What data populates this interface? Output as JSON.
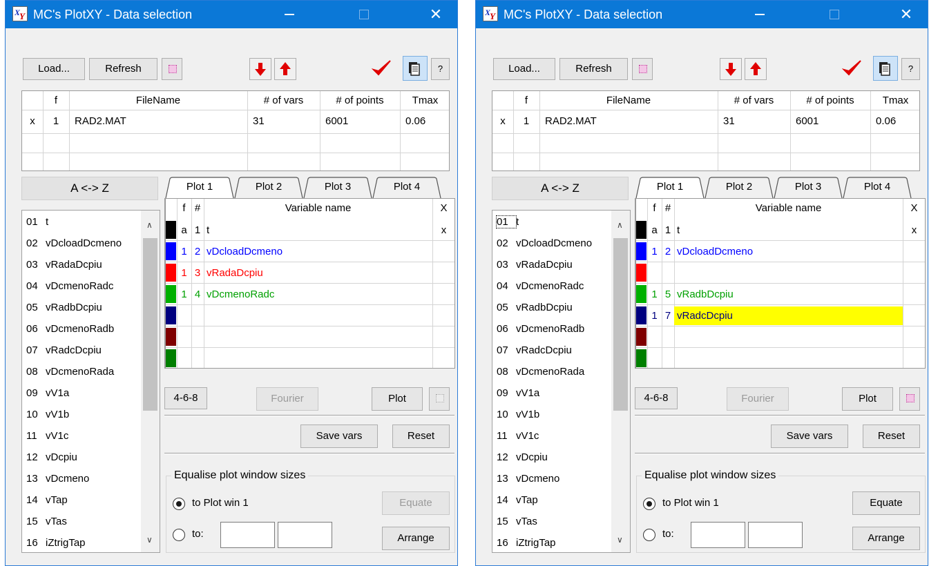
{
  "windows": [
    {
      "title": "MC's PlotXY - Data selection",
      "toolbar": {
        "load": "Load...",
        "refresh": "Refresh",
        "help": "?"
      },
      "files": {
        "headers": [
          "f",
          "FileName",
          "# of vars",
          "# of points",
          "Tmax"
        ],
        "rows": [
          {
            "sel": "x",
            "f": "1",
            "name": "RAD2.MAT",
            "vars": "31",
            "points": "6001",
            "tmax": "0.06"
          }
        ]
      },
      "az_label": "A <-> Z",
      "var_list": [
        {
          "num": "01",
          "name": "t"
        },
        {
          "num": "02",
          "name": "vDcloadDcmeno"
        },
        {
          "num": "03",
          "name": "vRadaDcpiu"
        },
        {
          "num": "04",
          "name": "vDcmenoRadc"
        },
        {
          "num": "05",
          "name": "vRadbDcpiu"
        },
        {
          "num": "06",
          "name": "vDcmenoRadb"
        },
        {
          "num": "07",
          "name": "vRadcDcpiu"
        },
        {
          "num": "08",
          "name": "vDcmenoRada"
        },
        {
          "num": "09",
          "name": "vV1a"
        },
        {
          "num": "10",
          "name": "vV1b"
        },
        {
          "num": "11",
          "name": "vV1c"
        },
        {
          "num": "12",
          "name": "vDcpiu"
        },
        {
          "num": "13",
          "name": "vDcmeno"
        },
        {
          "num": "14",
          "name": "vTap"
        },
        {
          "num": "15",
          "name": "vTas"
        },
        {
          "num": "16",
          "name": "iZtrigTap"
        }
      ],
      "tabs": [
        "Plot 1",
        "Plot 2",
        "Plot 3",
        "Plot 4"
      ],
      "active_tab": "Plot 1",
      "plot_vars": {
        "headers": [
          "f",
          "#",
          "Variable name",
          "X"
        ],
        "rows": [
          {
            "color": "#000000",
            "f": "a",
            "num": "1",
            "name": "t",
            "x": "x",
            "text_color": "#000000",
            "highlight": false
          },
          {
            "color": "#0000ff",
            "f": "1",
            "num": "2",
            "name": "vDcloadDcmeno",
            "x": "",
            "text_color": "#0000ff",
            "highlight": false
          },
          {
            "color": "#ff0000",
            "f": "1",
            "num": "3",
            "name": "vRadaDcpiu",
            "x": "",
            "text_color": "#ff0000",
            "highlight": false
          },
          {
            "color": "#00b000",
            "f": "1",
            "num": "4",
            "name": "vDcmenoRadc",
            "x": "",
            "text_color": "#00a000",
            "highlight": false
          },
          {
            "color": "#00007f",
            "f": "",
            "num": "",
            "name": "",
            "x": "",
            "text_color": "#000000",
            "highlight": false
          },
          {
            "color": "#7f0000",
            "f": "",
            "num": "",
            "name": "",
            "x": "",
            "text_color": "#000000",
            "highlight": false
          },
          {
            "color": "#007f00",
            "f": "",
            "num": "",
            "name": "",
            "x": "",
            "text_color": "#000000",
            "highlight": false
          }
        ]
      },
      "buttons": {
        "scheme": "4-6-8",
        "fourier": "Fourier",
        "plot": "Plot",
        "save_vars": "Save vars",
        "reset": "Reset",
        "equate": "Equate",
        "arrange": "Arrange"
      },
      "equalise": {
        "title": "Equalise plot window sizes",
        "opt1": "to Plot win 1",
        "opt2": "to:",
        "selected": "opt1"
      },
      "equate_enabled": false
    },
    {
      "title": "MC's PlotXY - Data selection",
      "toolbar": {
        "load": "Load...",
        "refresh": "Refresh",
        "help": "?"
      },
      "files": {
        "headers": [
          "f",
          "FileName",
          "# of vars",
          "# of points",
          "Tmax"
        ],
        "rows": [
          {
            "sel": "x",
            "f": "1",
            "name": "RAD2.MAT",
            "vars": "31",
            "points": "6001",
            "tmax": "0.06"
          }
        ]
      },
      "az_label": "A <-> Z",
      "var_list": [
        {
          "num": "01",
          "name": "t"
        },
        {
          "num": "02",
          "name": "vDcloadDcmeno"
        },
        {
          "num": "03",
          "name": "vRadaDcpiu"
        },
        {
          "num": "04",
          "name": "vDcmenoRadc"
        },
        {
          "num": "05",
          "name": "vRadbDcpiu"
        },
        {
          "num": "06",
          "name": "vDcmenoRadb"
        },
        {
          "num": "07",
          "name": "vRadcDcpiu"
        },
        {
          "num": "08",
          "name": "vDcmenoRada"
        },
        {
          "num": "09",
          "name": "vV1a"
        },
        {
          "num": "10",
          "name": "vV1b"
        },
        {
          "num": "11",
          "name": "vV1c"
        },
        {
          "num": "12",
          "name": "vDcpiu"
        },
        {
          "num": "13",
          "name": "vDcmeno"
        },
        {
          "num": "14",
          "name": "vTap"
        },
        {
          "num": "15",
          "name": "vTas"
        },
        {
          "num": "16",
          "name": "iZtrigTap"
        }
      ],
      "tabs": [
        "Plot 1",
        "Plot 2",
        "Plot 3",
        "Plot 4"
      ],
      "active_tab": "Plot 1",
      "plot_vars": {
        "headers": [
          "f",
          "#",
          "Variable name",
          "X"
        ],
        "rows": [
          {
            "color": "#000000",
            "f": "a",
            "num": "1",
            "name": "t",
            "x": "x",
            "text_color": "#000000",
            "highlight": false
          },
          {
            "color": "#0000ff",
            "f": "1",
            "num": "2",
            "name": "vDcloadDcmeno",
            "x": "",
            "text_color": "#0000ff",
            "highlight": false
          },
          {
            "color": "#ff0000",
            "f": "",
            "num": "",
            "name": "",
            "x": "",
            "text_color": "#000000",
            "highlight": false
          },
          {
            "color": "#00b000",
            "f": "1",
            "num": "5",
            "name": "vRadbDcpiu",
            "x": "",
            "text_color": "#00a000",
            "highlight": false
          },
          {
            "color": "#00007f",
            "f": "1",
            "num": "7",
            "name": "vRadcDcpiu",
            "x": "",
            "text_color": "#00007f",
            "highlight": true
          },
          {
            "color": "#7f0000",
            "f": "",
            "num": "",
            "name": "",
            "x": "",
            "text_color": "#000000",
            "highlight": false
          },
          {
            "color": "#007f00",
            "f": "",
            "num": "",
            "name": "",
            "x": "",
            "text_color": "#000000",
            "highlight": false
          }
        ]
      },
      "buttons": {
        "scheme": "4-6-8",
        "fourier": "Fourier",
        "plot": "Plot",
        "save_vars": "Save vars",
        "reset": "Reset",
        "equate": "Equate",
        "arrange": "Arrange"
      },
      "equalise": {
        "title": "Equalise plot window sizes",
        "opt1": "to Plot win 1",
        "opt2": "to:",
        "selected": "opt1"
      },
      "equate_enabled": true
    }
  ],
  "icons": {
    "close": "close-icon",
    "minimize": "minimize-icon",
    "maximize": "maximize-icon",
    "down": "red-down-arrow-icon",
    "up": "red-up-arrow-icon",
    "check": "red-check-icon",
    "copy": "copy-icon"
  }
}
